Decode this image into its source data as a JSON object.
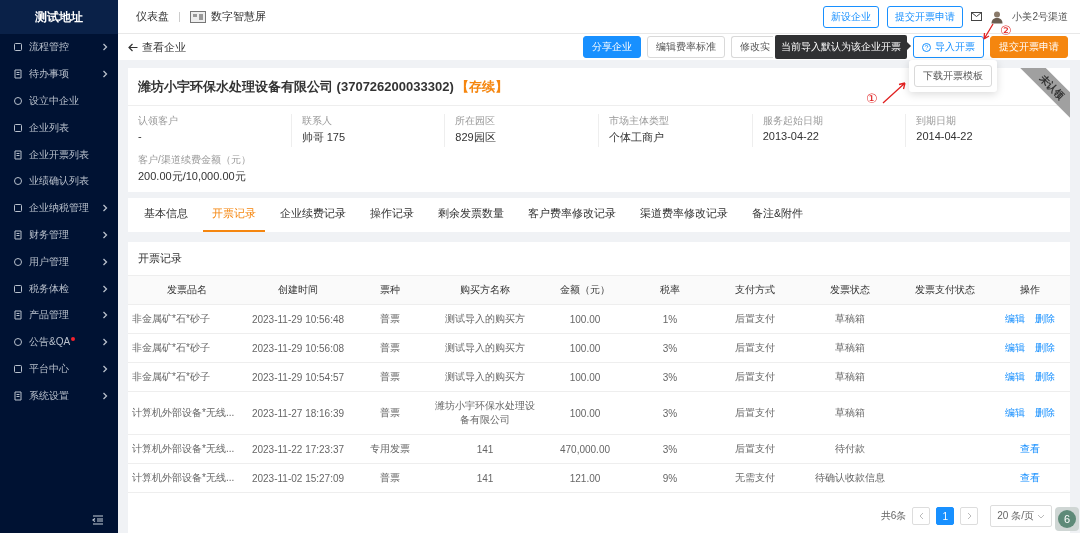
{
  "sidebar": {
    "logo": "测试地址",
    "items": [
      {
        "label": "流程管控",
        "expandable": true,
        "dot": false
      },
      {
        "label": "待办事项",
        "expandable": true,
        "dot": false
      },
      {
        "label": "设立中企业",
        "expandable": false,
        "dot": false
      },
      {
        "label": "企业列表",
        "expandable": false,
        "dot": false
      },
      {
        "label": "企业开票列表",
        "expandable": false,
        "dot": false
      },
      {
        "label": "业绩确认列表",
        "expandable": false,
        "dot": false
      },
      {
        "label": "企业纳税管理",
        "expandable": true,
        "dot": false
      },
      {
        "label": "财务管理",
        "expandable": true,
        "dot": false
      },
      {
        "label": "用户管理",
        "expandable": true,
        "dot": false
      },
      {
        "label": "税务体检",
        "expandable": true,
        "dot": false
      },
      {
        "label": "产品管理",
        "expandable": true,
        "dot": false
      },
      {
        "label": "公告&QA",
        "expandable": true,
        "dot": true
      },
      {
        "label": "平台中心",
        "expandable": true,
        "dot": false
      },
      {
        "label": "系统设置",
        "expandable": true,
        "dot": false
      }
    ]
  },
  "topbar": {
    "nav": [
      {
        "label": "仪表盘",
        "kind": "text"
      },
      {
        "label": "数字智慧屏",
        "kind": "screen"
      }
    ],
    "buttons": [
      "新设企业",
      "提交开票申请"
    ],
    "user": "小美2号渠道"
  },
  "subbar": {
    "back": "查看企业",
    "buttons": [
      {
        "label": "分享企业",
        "kind": "primary"
      },
      {
        "label": "编辑费率标准",
        "kind": "default"
      },
      {
        "label": "修改实",
        "kind": "cut"
      },
      {
        "label": "导入开票",
        "kind": "import"
      },
      {
        "label": "提交开票申请",
        "kind": "warning"
      }
    ],
    "tooltip": "当前导入默认为该企业开票",
    "dropdown": [
      "下载开票模板"
    ]
  },
  "annotations": [
    "①",
    "②"
  ],
  "company": {
    "name": "潍坊小宇环保水处理设备有限公司 (370726200033302)",
    "status": "【存续】",
    "ribbon": "未认领",
    "fields": [
      {
        "label": "认领客户",
        "value": "-"
      },
      {
        "label": "联系人",
        "value": "帅哥 175"
      },
      {
        "label": "所在园区",
        "value": "829园区"
      },
      {
        "label": "市场主体类型",
        "value": "个体工商户"
      },
      {
        "label": "服务起始日期",
        "value": "2013-04-22"
      },
      {
        "label": "到期日期",
        "value": "2014-04-22"
      }
    ],
    "fee": {
      "label": "客户/渠道续费金额（元）",
      "value": "200.00元/10,000.00元"
    }
  },
  "tabs": [
    {
      "label": "基本信息",
      "selected": false
    },
    {
      "label": "开票记录",
      "selected": true
    },
    {
      "label": "企业续费记录",
      "selected": false
    },
    {
      "label": "操作记录",
      "selected": false
    },
    {
      "label": "剩余发票数量",
      "selected": false
    },
    {
      "label": "客户费率修改记录",
      "selected": false
    },
    {
      "label": "渠道费率修改记录",
      "selected": false
    },
    {
      "label": "备注&附件",
      "selected": false
    }
  ],
  "records": {
    "title": "开票记录",
    "columns": [
      "发票品名",
      "创建时间",
      "票种",
      "购买方名称",
      "金额（元）",
      "税率",
      "支付方式",
      "发票状态",
      "发票支付状态",
      "操作"
    ],
    "rows": [
      {
        "name": "非金属矿*石*砂子",
        "created": "2023-11-29 10:56:48",
        "type": "普票",
        "buyer": "测试导入的购买方",
        "amount": "100.00",
        "rate": "1%",
        "payment": "后置支付",
        "status": "草稿箱",
        "actions": [
          "编辑",
          "删除"
        ]
      },
      {
        "name": "非金属矿*石*砂子",
        "created": "2023-11-29 10:56:08",
        "type": "普票",
        "buyer": "测试导入的购买方",
        "amount": "100.00",
        "rate": "3%",
        "payment": "后置支付",
        "status": "草稿箱",
        "actions": [
          "编辑",
          "删除"
        ]
      },
      {
        "name": "非金属矿*石*砂子",
        "created": "2023-11-29 10:54:57",
        "type": "普票",
        "buyer": "测试导入的购买方",
        "amount": "100.00",
        "rate": "3%",
        "payment": "后置支付",
        "status": "草稿箱",
        "actions": [
          "编辑",
          "删除"
        ]
      },
      {
        "name": "计算机外部设备*无线...",
        "created": "2023-11-27 18:16:39",
        "type": "普票",
        "buyer": "潍坊小宇环保水处理设备有限公司",
        "amount": "100.00",
        "rate": "3%",
        "payment": "后置支付",
        "status": "草稿箱",
        "actions": [
          "编辑",
          "删除"
        ]
      },
      {
        "name": "计算机外部设备*无线...",
        "created": "2023-11-22 17:23:37",
        "type": "专用发票",
        "buyer": "141",
        "amount": "470,000.00",
        "rate": "3%",
        "payment": "后置支付",
        "status": "待付款",
        "actions": [
          "查看"
        ]
      },
      {
        "name": "计算机外部设备*无线...",
        "created": "2023-11-02 15:27:09",
        "type": "普票",
        "buyer": "141",
        "amount": "121.00",
        "rate": "9%",
        "payment": "无需支付",
        "status": "待确认收款信息",
        "actions": [
          "查看"
        ]
      }
    ],
    "pagination": {
      "total": "共6条",
      "pages": [
        {
          "label": "1",
          "selected": true
        }
      ],
      "page_size": "20 条/页"
    }
  },
  "corner_badge": "6"
}
